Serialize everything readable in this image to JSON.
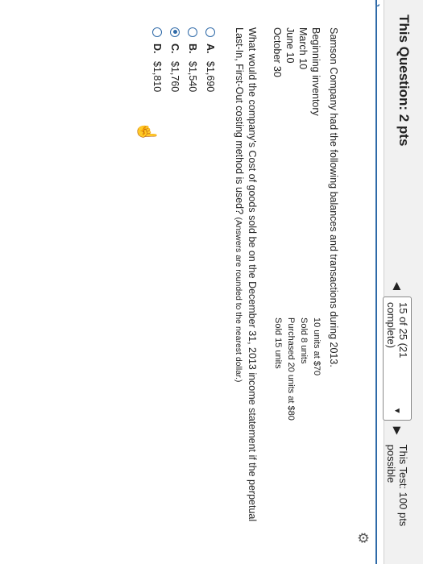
{
  "header": {
    "question_title": "This Question: 2 pts",
    "progress": "15 of 25 (21 complete)",
    "test_info": "This Test: 100 pts possible"
  },
  "icons": {
    "prev": "previous-question-icon",
    "dropdown": "dropdown-arrow-icon",
    "next": "next-question-icon",
    "gear": "gear-icon",
    "back": "back-arrow-icon",
    "cursor": "hand-pointer-icon"
  },
  "problem": {
    "intro": "Samson Company had the following balances and transactions during 2013.",
    "transactions": [
      {
        "desc": "Beginning inventory",
        "value": "10 units at $70"
      },
      {
        "desc": "March 10",
        "value": "Sold 8 units"
      },
      {
        "desc": "June 10",
        "value": "Purchased 20 units at $80"
      },
      {
        "desc": "October 30",
        "value": "Sold 15 units"
      }
    ],
    "question_main": "What would the company's Cost of goods sold be on the December 31, 2013 income statement if the perpetual",
    "question_tail": "Last-In, First-Out costing method is used?",
    "question_note": "(Answers are rounded to the nearest dollar.)"
  },
  "options": [
    {
      "letter": "A.",
      "text": "$1,690",
      "selected": false
    },
    {
      "letter": "B.",
      "text": "$1,540",
      "selected": false
    },
    {
      "letter": "C.",
      "text": "$1,760",
      "selected": true
    },
    {
      "letter": "D.",
      "text": "$1,810",
      "selected": false
    }
  ],
  "colors": {
    "accent": "#2f6aa8",
    "header_bg": "#f1f1f1"
  }
}
